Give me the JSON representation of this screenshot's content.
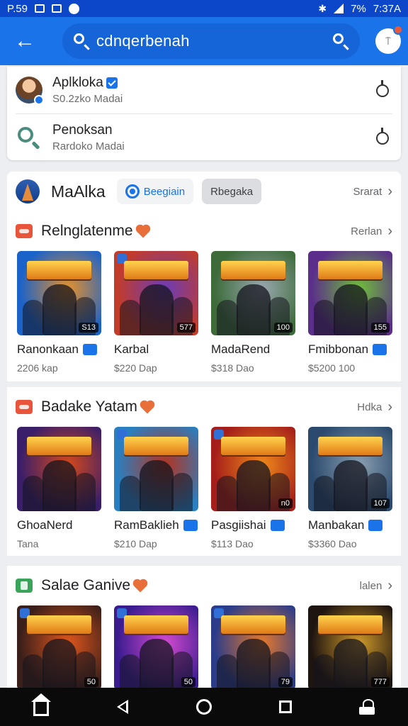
{
  "status": {
    "time_left": "P.59",
    "battery": "7%",
    "clock": "7:37A"
  },
  "header": {
    "search_text": "cdnqerbenah",
    "icons": [
      "back-arrow-icon",
      "search-icon",
      "profile-icon"
    ]
  },
  "suggestions": [
    {
      "title": "Aplkloka",
      "subtitle": "S0.2zko Madai",
      "icon": "avatar"
    },
    {
      "title": "Penoksan",
      "subtitle": "Rardoko Madai",
      "icon": "search-icon"
    }
  ],
  "category": {
    "title": "MaAlka",
    "chip_primary": "Beegiain",
    "chip_secondary": "Rbegaka",
    "more": "Srarat"
  },
  "sections": [
    {
      "title": "Relnglatenme",
      "more": "Rerlan",
      "items": [
        {
          "name": "Ranonkaan",
          "price": "2206 kap",
          "tag": "S13",
          "badge": true
        },
        {
          "name": "Karbal",
          "price": "$220 Dap",
          "tag": "577",
          "badge": false
        },
        {
          "name": "MadaRend",
          "price": "$318 Dao",
          "tag": "100",
          "badge": false
        },
        {
          "name": "Fmibbonan",
          "price": "$5200 100",
          "tag": "155",
          "badge": true
        }
      ]
    },
    {
      "title": "Badake Yatam",
      "more": "Hdka",
      "items": [
        {
          "name": "GhoaNerd",
          "price": "Tana",
          "tag": "",
          "badge": false
        },
        {
          "name": "RamBaklieh",
          "price": "$210 Dap",
          "tag": "",
          "badge": true
        },
        {
          "name": "Pasgiishai",
          "price": "$113 Dao",
          "tag": "n0",
          "badge": true
        },
        {
          "name": "Manbakan",
          "price": "$3360 Dao",
          "tag": "107",
          "badge": true
        }
      ]
    },
    {
      "title": "Salae Ganive",
      "more": "lalen",
      "items": [
        {
          "name": "",
          "price": "",
          "tag": "50",
          "badge": false
        },
        {
          "name": "",
          "price": "",
          "tag": "50",
          "badge": false
        },
        {
          "name": "",
          "price": "",
          "tag": "79",
          "badge": false
        },
        {
          "name": "",
          "price": "",
          "tag": "777",
          "badge": false
        }
      ]
    }
  ],
  "thumb_colors": [
    [
      "#1b62c9",
      "#e6912a"
    ],
    [
      "#c23c2a",
      "#6a3cb8"
    ],
    [
      "#3d6b3a",
      "#9aa8b0"
    ],
    [
      "#5a2e8a",
      "#6fbf3a"
    ],
    [
      "#3a1e6a",
      "#d5491a"
    ],
    [
      "#2a7fc0",
      "#b5331f"
    ],
    [
      "#a51e1a",
      "#f08a1a"
    ],
    [
      "#2b4a6e",
      "#8a9fb0"
    ],
    [
      "#3b1f1a",
      "#e2571c"
    ],
    [
      "#3a1c8f",
      "#d64bd1"
    ],
    [
      "#2a3c8a",
      "#e9792a"
    ],
    [
      "#1e1410",
      "#d09a2a"
    ]
  ]
}
